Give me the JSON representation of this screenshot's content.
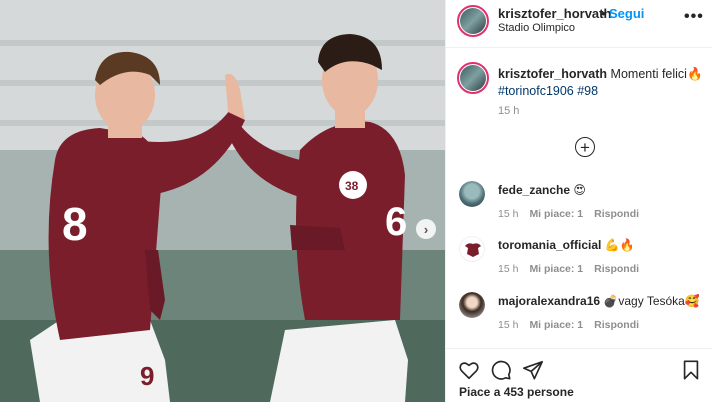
{
  "post": {
    "username": "krisztofer_horvath",
    "follow_label": "Segui",
    "dot": "•",
    "location": "Stadio Olimpico",
    "caption_text": "Momenti felici🔥",
    "hashtags": "#torinofc1906 #98",
    "caption_time": "15 h",
    "likes_text": "Piace a 453 persone",
    "jersey_left_number": "8",
    "jersey_left_shorts": "9",
    "jersey_right_number": "6"
  },
  "comments": [
    {
      "username": "fede_zanche",
      "text": "😍",
      "time": "15 h",
      "likes": "Mi piace: 1",
      "reply": "Rispondi"
    },
    {
      "username": "toromania_official",
      "text": "💪🔥",
      "time": "15 h",
      "likes": "Mi piace: 1",
      "reply": "Rispondi"
    },
    {
      "username": "majoralexandra16",
      "text": "💣vagy Tesóka🥰",
      "time": "15 h",
      "likes": "Mi piace: 1",
      "reply": "Rispondi"
    }
  ],
  "icons": {
    "more": "more-options-icon",
    "load_more": "add-comments-icon",
    "like": "heart-icon",
    "comment": "comment-icon",
    "share": "share-icon",
    "save": "bookmark-icon",
    "next": "chevron-right-icon"
  },
  "colors": {
    "jersey": "#7a1e2c",
    "link": "#0095f6",
    "hashtag": "#00376b",
    "muted": "#8e8e8e"
  }
}
